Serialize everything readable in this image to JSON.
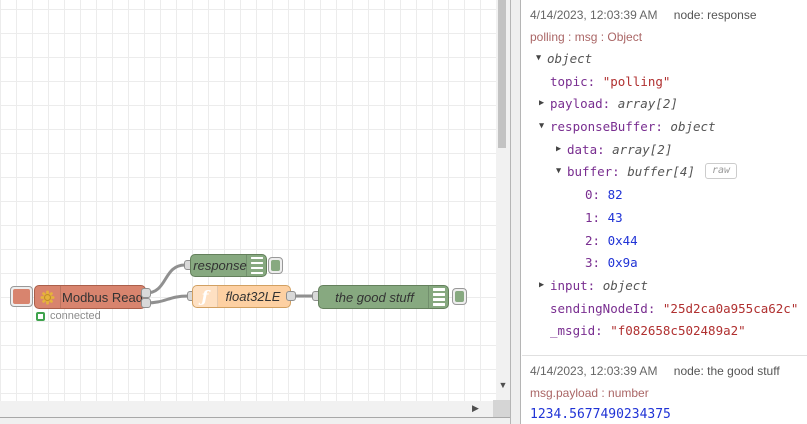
{
  "canvas": {
    "nodes": {
      "modbus": {
        "label": "Modbus Read",
        "status": "connected",
        "color": "#d8846e"
      },
      "response": {
        "label": "response",
        "color": "#87a980"
      },
      "func": {
        "label": "float32LE",
        "color": "#fdd0a2"
      },
      "goodstuff": {
        "label": "the good stuff",
        "color": "#87a980"
      }
    },
    "status_color": "#3fa34d",
    "wire_color": "#909090"
  },
  "sidebar": {
    "raw_label": "raw",
    "colors": {
      "key": "#792e90",
      "string": "#b03030",
      "number": "#2033d6",
      "meta_line": "#a66"
    },
    "messages": [
      {
        "timestamp": "4/14/2023, 12:03:39 AM",
        "node": "node: response",
        "meta": "polling : msg : Object",
        "tree": [
          {
            "indent": 0,
            "arrow": "expanded",
            "key": "",
            "value": "object",
            "vtype": "meta"
          },
          {
            "indent": 1,
            "arrow": "",
            "key": "topic",
            "value": "\"polling\"",
            "vtype": "string"
          },
          {
            "indent": 1,
            "arrow": "collapsed",
            "key": "payload",
            "value": "array[2]",
            "vtype": "meta"
          },
          {
            "indent": 1,
            "arrow": "expanded",
            "key": "responseBuffer",
            "value": "object",
            "vtype": "meta"
          },
          {
            "indent": 2,
            "arrow": "collapsed",
            "key": "data",
            "value": "array[2]",
            "vtype": "meta"
          },
          {
            "indent": 2,
            "arrow": "expanded",
            "key": "buffer",
            "value": "buffer[4]",
            "vtype": "meta",
            "raw": true
          },
          {
            "indent": 3,
            "arrow": "",
            "key": "0",
            "value": "82",
            "vtype": "number"
          },
          {
            "indent": 3,
            "arrow": "",
            "key": "1",
            "value": "43",
            "vtype": "number"
          },
          {
            "indent": 3,
            "arrow": "",
            "key": "2",
            "value": "0x44",
            "vtype": "number"
          },
          {
            "indent": 3,
            "arrow": "",
            "key": "3",
            "value": "0x9a",
            "vtype": "number"
          },
          {
            "indent": 1,
            "arrow": "collapsed",
            "key": "input",
            "value": "object",
            "vtype": "meta"
          },
          {
            "indent": 1,
            "arrow": "",
            "key": "sendingNodeId",
            "value": "\"25d2ca0a955ca62c\"",
            "vtype": "string"
          },
          {
            "indent": 1,
            "arrow": "",
            "key": "_msgid",
            "value": "\"f082658c502489a2\"",
            "vtype": "string"
          }
        ]
      },
      {
        "timestamp": "4/14/2023, 12:03:39 AM",
        "node": "node: the good stuff",
        "meta": "msg.payload : number",
        "payload": "1234.5677490234375"
      }
    ]
  }
}
